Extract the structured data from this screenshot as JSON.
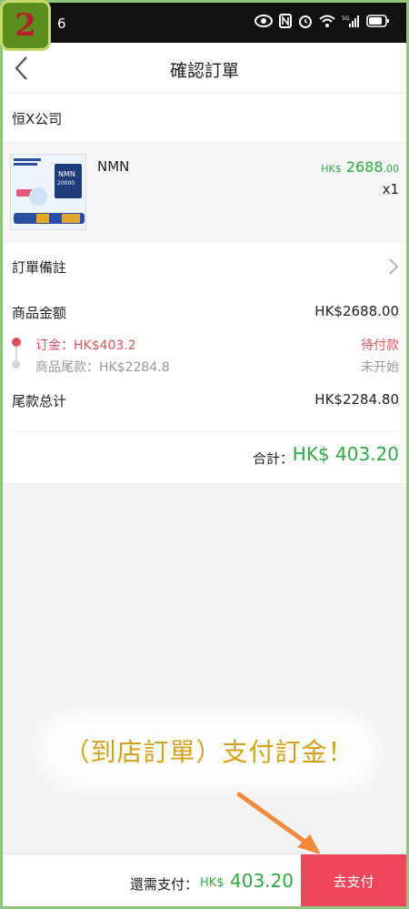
{
  "step_badge": "2",
  "status_bar": {
    "time_fragment": "6"
  },
  "nav": {
    "title": "確認訂單",
    "back_icon": "chevron-left-icon"
  },
  "shop": {
    "name": "恒X公司"
  },
  "product": {
    "name": "NMN",
    "price_currency": "HK$",
    "price_int": "2688",
    "price_dec": ".00",
    "quantity": "x1",
    "image_texts": [
      "NMN",
      "20000"
    ]
  },
  "notes": {
    "label": "訂單備註"
  },
  "amounts": {
    "goods_label": "商品金额",
    "goods_value": "HK$2688.00",
    "deposit_label": "订金：HK$403.2",
    "deposit_status": "待付款",
    "balance_label": "商品尾款：HK$2284.8",
    "balance_status": "未开始",
    "balance_total_label": "尾款总计",
    "balance_total_value": "HK$2284.80",
    "total_label": "合計：",
    "total_value": "HK$ 403.20"
  },
  "caption": "（到店訂單）支付訂金！",
  "bottom": {
    "due_label": "還需支付：",
    "due_currency": "HK$",
    "due_amount": "403.20",
    "pay_button": "去支付"
  },
  "colors": {
    "accent_green": "#2eaa44",
    "pay_red": "#f0455a",
    "deposit_red": "#e0525a",
    "caption_gold": "#d4a21a"
  }
}
